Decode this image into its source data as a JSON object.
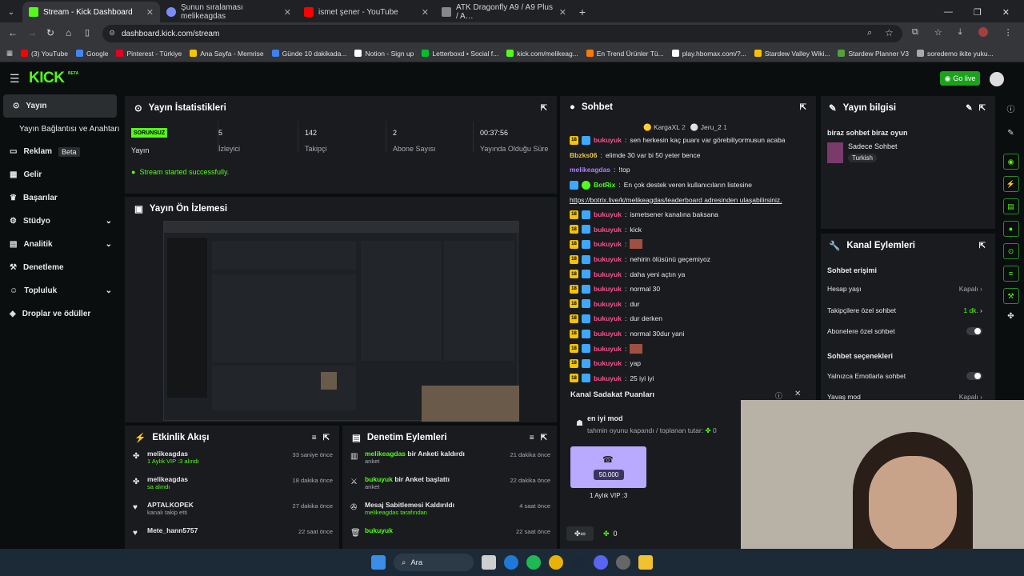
{
  "browser": {
    "tabs": [
      {
        "title": "Stream - Kick Dashboard",
        "color": "#53fc18"
      },
      {
        "title": "Şunun sıralaması melikeagdas",
        "color": "#7b8cff"
      },
      {
        "title": "ismet şener - YouTube",
        "color": "#ff0000"
      },
      {
        "title": "ATK Dragonfly A9 / A9 Plus / A…",
        "color": "#888888"
      }
    ],
    "url": "dashboard.kick.com/stream",
    "bookmarks": [
      "(3) YouTube",
      "Google",
      "Pinterest - Türkiye",
      "Ana Sayfa - Memrise",
      "Günde 10 dakikada...",
      "Notion - Sign up",
      "Letterboxd • Social f...",
      "kick.com/melikeag...",
      "En Trend Ürünler Tü...",
      "play.hbomax.com/?...",
      "Stardew Valley Wiki...",
      "Stardew Planner V3",
      "soredemo ikite yuku..."
    ]
  },
  "header": {
    "logo": "KICK",
    "beta": "BETA",
    "go_live": "Go live"
  },
  "sidebar": {
    "items": [
      {
        "label": "Yayın",
        "icon": "stream-icon"
      },
      {
        "label": "Yayın Bağlantısı ve Anahtarı",
        "icon": ""
      },
      {
        "label": "Reklam",
        "icon": "ads-icon",
        "badge": "Beta"
      },
      {
        "label": "Gelir",
        "icon": "revenue-icon"
      },
      {
        "label": "Başarılar",
        "icon": "trophy-icon"
      },
      {
        "label": "Stüdyo",
        "icon": "studio-icon"
      },
      {
        "label": "Analitik",
        "icon": "analytics-icon"
      },
      {
        "label": "Denetleme",
        "icon": "moderation-icon"
      },
      {
        "label": "Topluluk",
        "icon": "community-icon"
      },
      {
        "label": "Droplar ve ödüller",
        "icon": "drops-icon"
      }
    ]
  },
  "stats": {
    "title": "Yayın İstatistikleri",
    "status": "SORUNSUZ",
    "items": [
      {
        "value": "",
        "label": "Yayın"
      },
      {
        "value": "5",
        "label": "İzleyici"
      },
      {
        "value": "142",
        "label": "Takipçi"
      },
      {
        "value": "2",
        "label": "Abone Sayısı"
      },
      {
        "value": "00:37:56",
        "label": "Yayında Olduğu Süre"
      }
    ],
    "message": "Stream started successfully."
  },
  "preview": {
    "title": "Yayın Ön İzlemesi"
  },
  "activity": {
    "title": "Etkinlik Akışı",
    "items": [
      {
        "name": "melikeagdas",
        "detail": "1 Aylık VIP :3 alındı",
        "time": "33 saniye önce"
      },
      {
        "name": "melikeagdas",
        "detail": "sa alındı",
        "time": "18 dakika önce"
      },
      {
        "name": "APTALKOPEK",
        "detail": "kanalı takip etti",
        "time": "27 dakika önce"
      },
      {
        "name": "Mete_hann5757",
        "detail": "",
        "time": "22 saat önce"
      }
    ]
  },
  "modlog": {
    "title": "Denetim Eylemleri",
    "items": [
      {
        "user": "melikeagdas",
        "action": " bir Anketi kaldırdı",
        "sub": "anket",
        "time": "21 dakika önce"
      },
      {
        "user": "bukuyuk",
        "action": " bir Anket başlattı",
        "sub": "anket",
        "time": "22 dakika önce"
      },
      {
        "user": "",
        "action": "Mesaj Sabitlemesi Kaldırıldı",
        "sub": "melikeagdas tarafından",
        "time": "4 saat önce"
      },
      {
        "user": "bukuyuk",
        "action": "",
        "sub": "",
        "time": "22 saat önce"
      }
    ]
  },
  "chat": {
    "title": "Sohbet",
    "top": [
      {
        "name": "KargaXL",
        "n": "2"
      },
      {
        "name": "Jeru_2",
        "n": "1"
      }
    ],
    "lines": [
      {
        "badge": "18",
        "user": "bukuyuk",
        "text": "sen herkesin kaç puanı var görebiliyormusun acaba",
        "color": "#ff4f8a"
      },
      {
        "badge": "",
        "user": "Bbzks06",
        "text": "elimde 30 var bi 50 yeter bence",
        "color": "#e8c547"
      },
      {
        "badge": "",
        "user": "melikeagdas",
        "text": "!top",
        "color": "#b07cff"
      },
      {
        "badge": "bot",
        "user": "BotRix",
        "text": "En çok destek veren kullanıcıların listesine",
        "color": "#53fc18"
      },
      {
        "badge": "",
        "user": "",
        "text": "https://botrix.live/k/melikeagdas/leaderboard adresinden ulaşabilirsiniz.",
        "color": ""
      },
      {
        "badge": "18",
        "user": "bukuyuk",
        "text": "ismetsener kanalına baksana",
        "color": "#ff4f8a"
      },
      {
        "badge": "18",
        "user": "bukuyuk",
        "text": "kick",
        "color": "#ff4f8a"
      },
      {
        "badge": "18",
        "user": "bukuyuk",
        "text": "",
        "color": "#ff4f8a"
      },
      {
        "badge": "18",
        "user": "bukuyuk",
        "text": "nehirin ölüsünü geçemiyoz",
        "color": "#ff4f8a"
      },
      {
        "badge": "18",
        "user": "bukuyuk",
        "text": "daha yeni açtın ya",
        "color": "#ff4f8a"
      },
      {
        "badge": "18",
        "user": "bukuyuk",
        "text": "normal 30",
        "color": "#ff4f8a"
      },
      {
        "badge": "18",
        "user": "bukuyuk",
        "text": "dur",
        "color": "#ff4f8a"
      },
      {
        "badge": "18",
        "user": "bukuyuk",
        "text": "dur derken",
        "color": "#ff4f8a"
      },
      {
        "badge": "18",
        "user": "bukuyuk",
        "text": "normal 30dur yani",
        "color": "#ff4f8a"
      },
      {
        "badge": "18",
        "user": "bukuyuk",
        "text": "",
        "color": "#ff4f8a"
      },
      {
        "badge": "18",
        "user": "bukuyuk",
        "text": "yap",
        "color": "#ff4f8a"
      },
      {
        "badge": "18",
        "user": "bukuyuk",
        "text": "25 iyi iyi",
        "color": "#ff4f8a"
      }
    ],
    "loyalty": {
      "title": "Kanal Sadakat Puanları",
      "mod_title": "en iyi mod",
      "mod_text": "tahmin oyunu kapandı / toplanan tutar: ",
      "mod_amount": "0",
      "reward_cost": "50.000",
      "reward_name": "1 Aylık VIP :3"
    },
    "bottom_points": "0"
  },
  "info": {
    "title": "Yayın bilgisi",
    "stream_title": "biraz sohbet biraz oyun",
    "category": "Sadece Sohbet",
    "language": "Turkish"
  },
  "actions": {
    "title": "Kanal Eylemleri",
    "section1": "Sohbet erişimi",
    "rows": [
      {
        "label": "Hesap yaşı",
        "value": "Kapalı",
        "kind": "chevron"
      },
      {
        "label": "Takipçilere özel sohbet",
        "value": "1 dk.",
        "kind": "chevron"
      },
      {
        "label": "Abonelere özel sohbet",
        "value": "",
        "kind": "toggle"
      }
    ],
    "section2": "Sohbet seçenekleri",
    "rows2": [
      {
        "label": "Yalnızca Emotlarla sohbet",
        "value": "",
        "kind": "toggle"
      },
      {
        "label": "Yavaş mod",
        "value": "Kapalı",
        "kind": "chevron"
      }
    ]
  },
  "taskbar": {
    "search": "Ara"
  }
}
